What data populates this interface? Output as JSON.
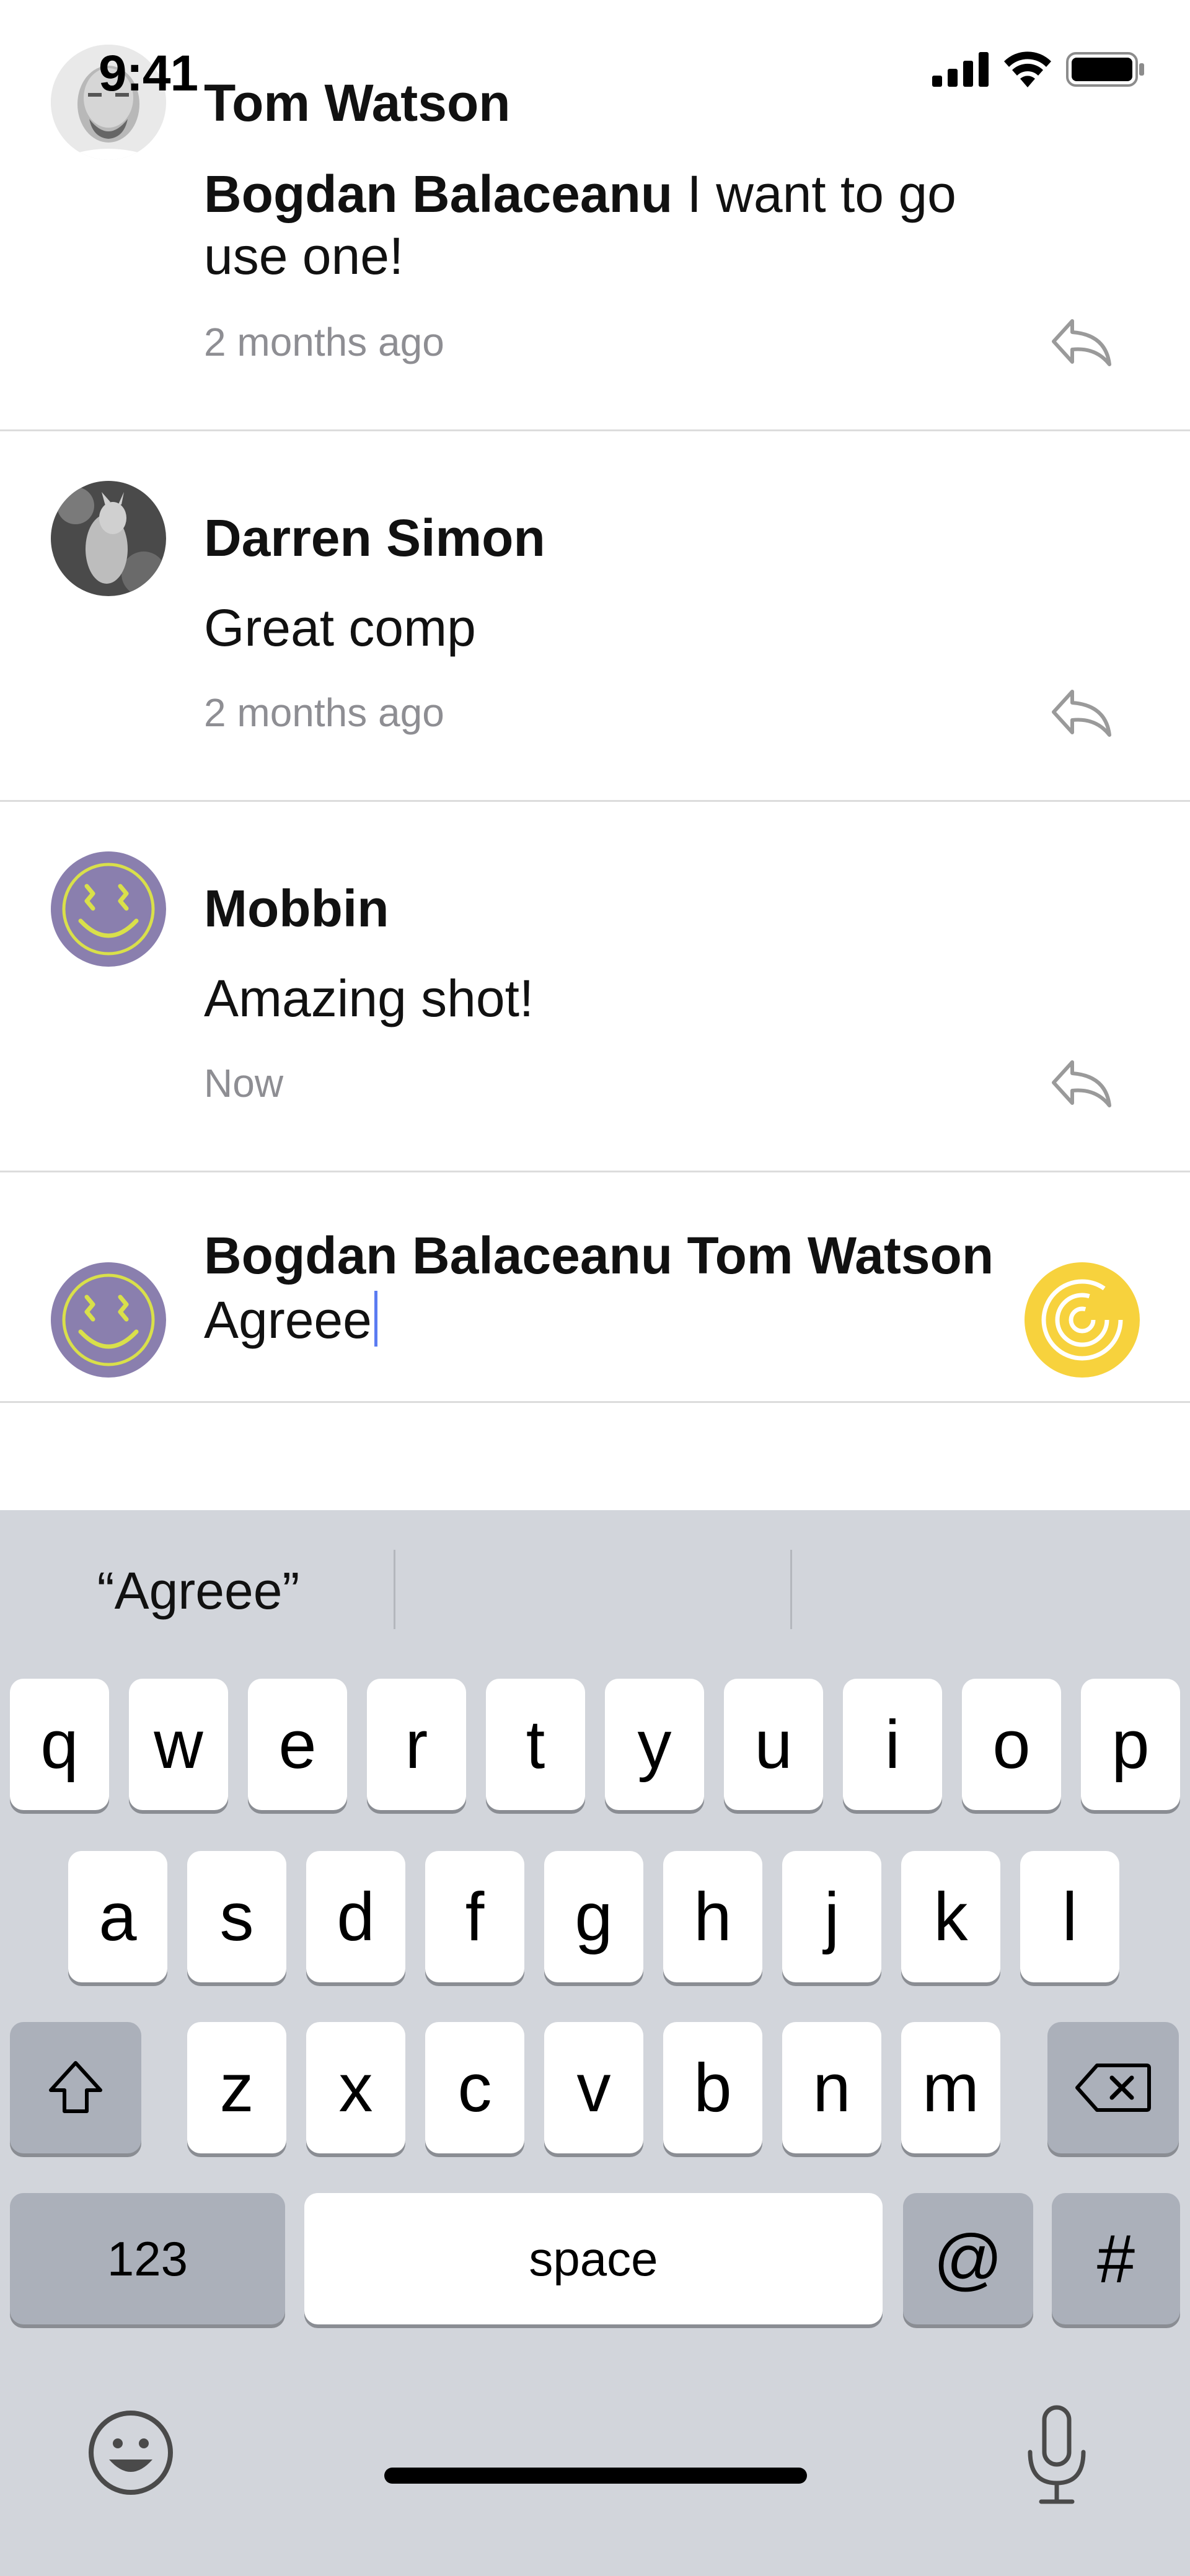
{
  "status_bar": {
    "time": "9:41"
  },
  "comments": [
    {
      "name": "Tom Watson",
      "mention": "Bogdan Balaceanu",
      "text": "I want to go use one!",
      "time": "2 months ago"
    },
    {
      "name": "Darren Simon",
      "text": "Great comp",
      "time": "2 months ago"
    },
    {
      "name": "Mobbin",
      "text": "Amazing shot!",
      "time": "Now"
    }
  ],
  "composer": {
    "mention_1": "Bogdan Balaceanu",
    "mention_2": "Tom Watson",
    "text": "Agreee"
  },
  "keyboard": {
    "predictions": [
      "“Agreee”",
      "",
      ""
    ],
    "row1": [
      "q",
      "w",
      "e",
      "r",
      "t",
      "y",
      "u",
      "i",
      "o",
      "p"
    ],
    "row2": [
      "a",
      "s",
      "d",
      "f",
      "g",
      "h",
      "j",
      "k",
      "l"
    ],
    "row3": [
      "z",
      "x",
      "c",
      "v",
      "b",
      "n",
      "m"
    ],
    "numbers_key": "123",
    "space_key": "space",
    "at_key": "@",
    "hash_key": "#"
  },
  "colors": {
    "accent_send": "#f7d23d",
    "avatar_purple": "#8a7fae",
    "avatar_lime": "#d9e04a",
    "caret": "#5b7cf2",
    "keyboard_bg": "#d2d5db"
  },
  "icons": [
    "signal-icon",
    "wifi-icon",
    "battery-icon",
    "reply-icon",
    "send-icon",
    "shift-icon",
    "backspace-icon",
    "emoji-icon",
    "microphone-icon"
  ]
}
